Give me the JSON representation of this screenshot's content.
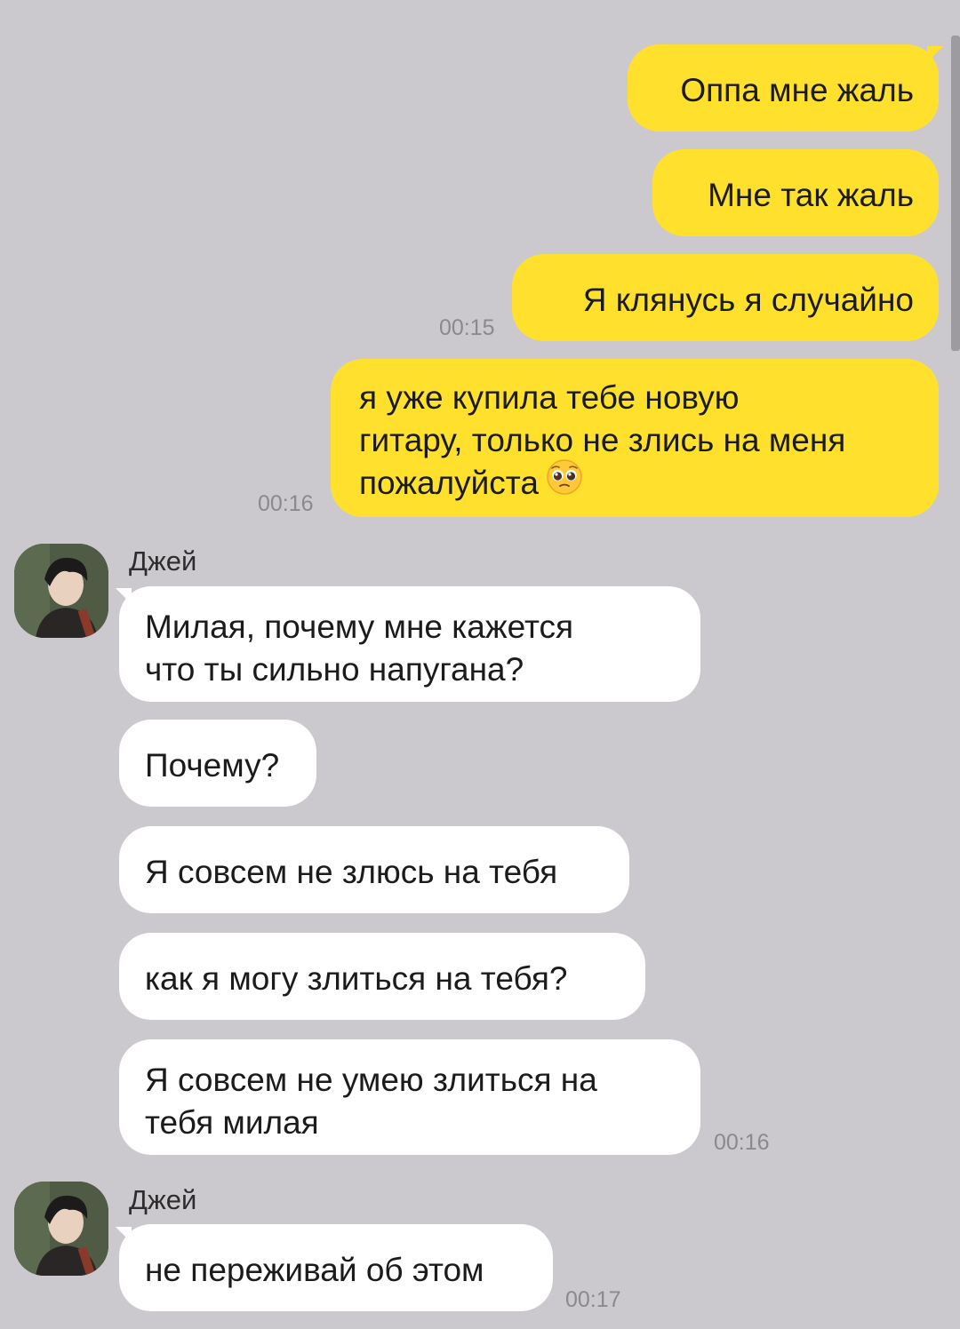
{
  "messages_out": [
    {
      "text": "Оппа мне жаль"
    },
    {
      "text": "Мне так жаль"
    },
    {
      "text": "Я клянусь я случайно",
      "time": "00:15"
    },
    {
      "line1": "я уже купила тебе новую",
      "line2": "гитару, только не злись на меня",
      "line3": "пожалуйста",
      "time": "00:16",
      "emoji": "pleading-face"
    }
  ],
  "group1": {
    "sender": "Джей",
    "messages": [
      {
        "line1": "Милая, почему мне кажется",
        "line2": "что ты сильно напугана?"
      },
      {
        "text": "Почему?"
      },
      {
        "text": "Я совсем не злюсь на тебя"
      },
      {
        "text": "как я могу злиться на тебя?"
      },
      {
        "line1": "Я совсем не умею злиться на",
        "line2": "тебя милая",
        "time": "00:16"
      }
    ]
  },
  "group2": {
    "sender": "Джей",
    "messages": [
      {
        "text": "не переживай об этом",
        "time": "00:17"
      }
    ]
  },
  "colors": {
    "background": "#ccc9ce",
    "outgoing_bubble": "#ffe12d",
    "incoming_bubble": "#ffffff",
    "timestamp": "#8c898e"
  }
}
